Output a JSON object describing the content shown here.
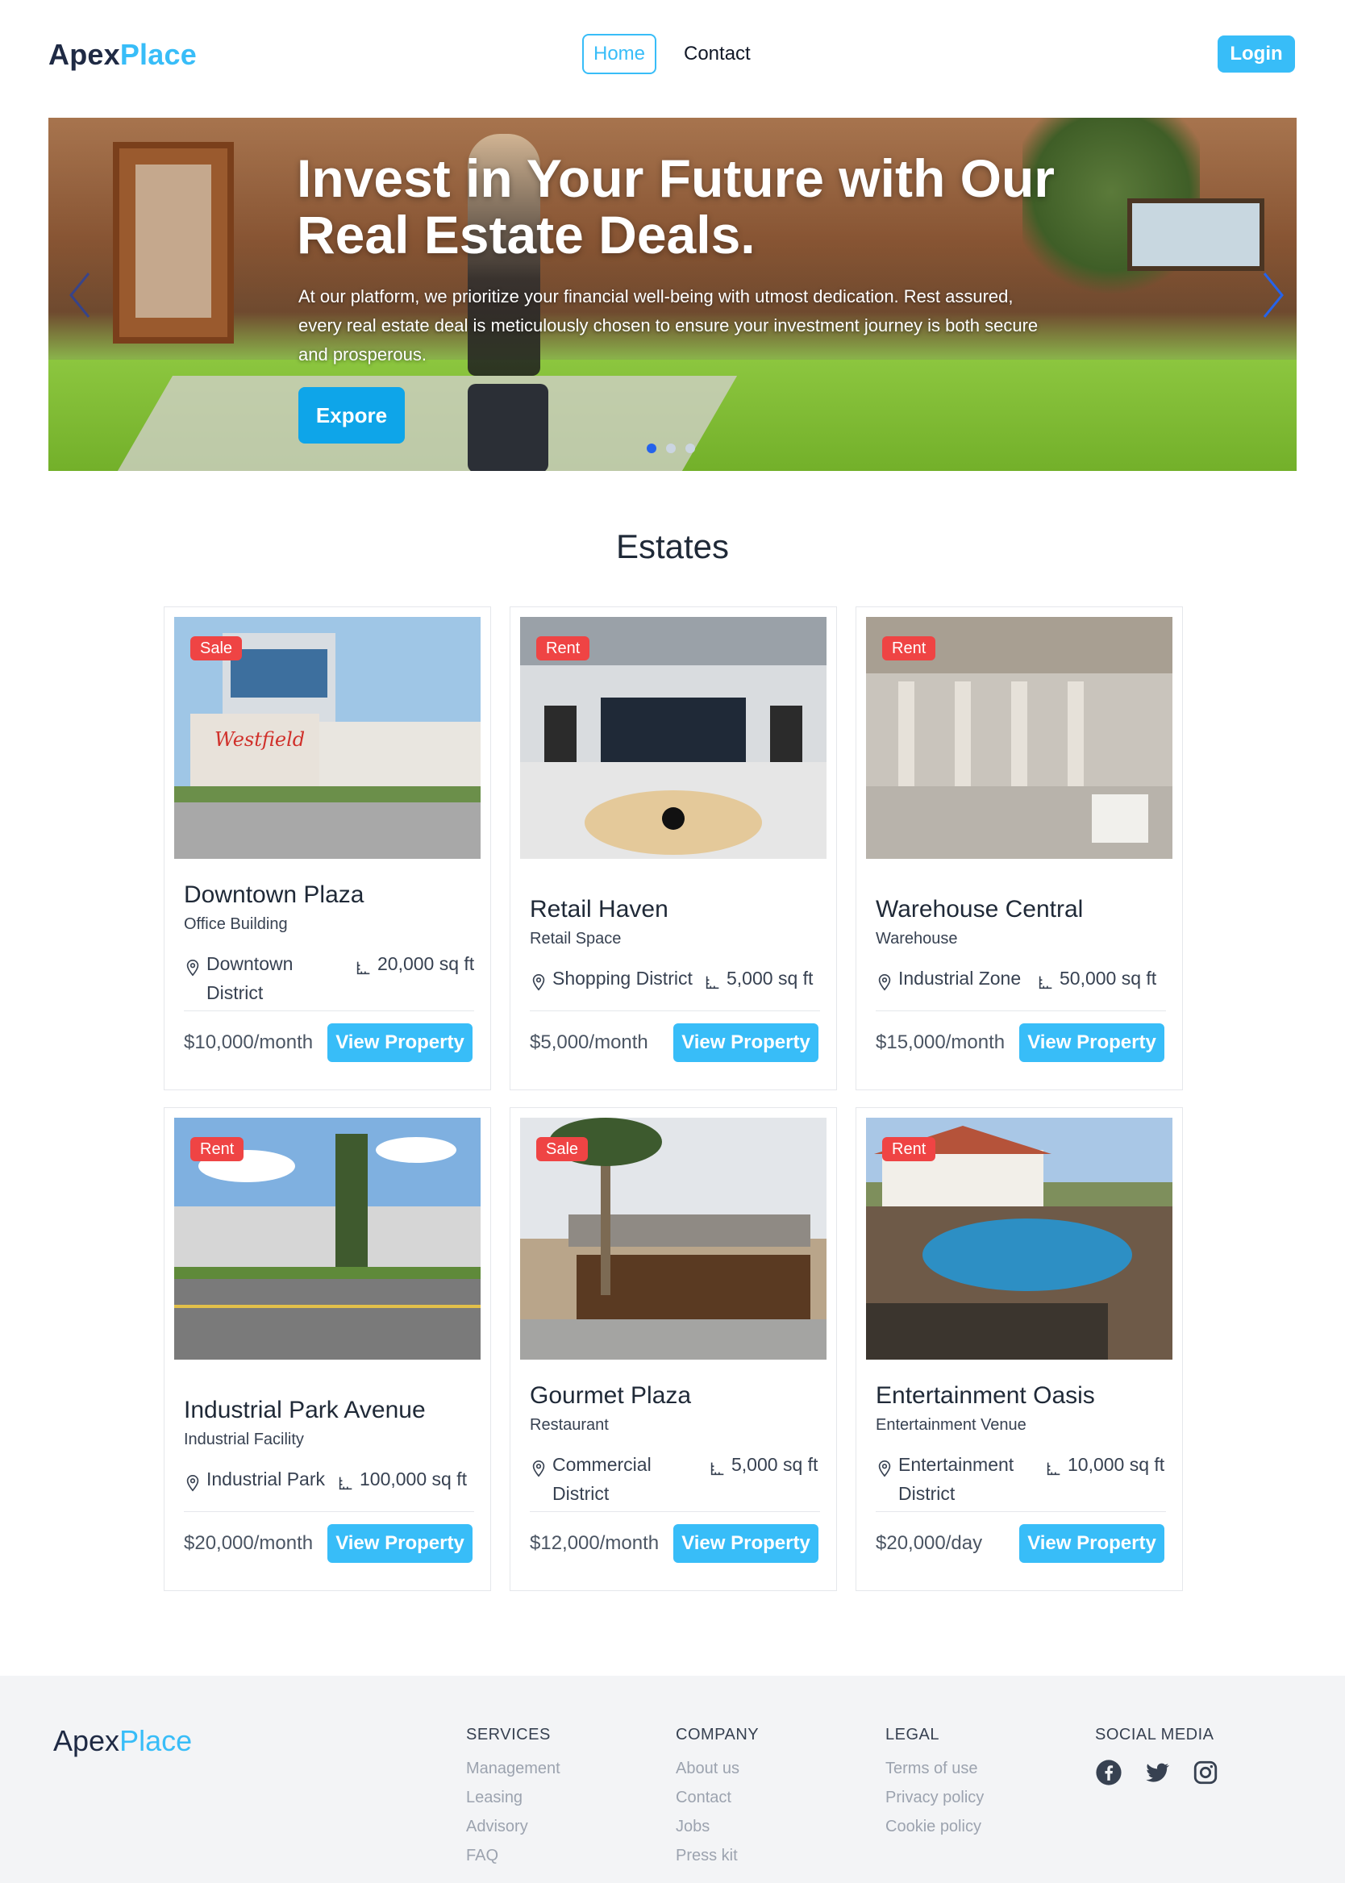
{
  "header": {
    "logo_part1": "Apex",
    "logo_part2": "Place",
    "nav": {
      "home": "Home",
      "contact": "Contact"
    },
    "login": "Login"
  },
  "hero": {
    "title": "Invest in Your Future with Our Real Estate Deals.",
    "text": "At our platform, we prioritize your financial well-being with utmost dedication. Rest assured, every real estate deal is meticulously chosen to ensure your investment journey is both secure and prosperous.",
    "button": "Expore",
    "slide_count": 3,
    "active_slide": 1
  },
  "estates": {
    "title": "Estates",
    "cards": [
      {
        "badge": "Sale",
        "name": "Downtown Plaza",
        "type": "Office Building",
        "location": "Downtown District",
        "area": "20,000 sq ft",
        "price": "$10,000/month",
        "button": "View Property"
      },
      {
        "badge": "Rent",
        "name": "Retail Haven",
        "type": "Retail Space",
        "location": "Shopping District",
        "area": "5,000 sq ft",
        "price": "$5,000/month",
        "button": "View Property"
      },
      {
        "badge": "Rent",
        "name": "Warehouse Central",
        "type": "Warehouse",
        "location": "Industrial Zone",
        "area": "50,000 sq ft",
        "price": "$15,000/month",
        "button": "View Property"
      },
      {
        "badge": "Rent",
        "name": "Industrial Park Avenue",
        "type": "Industrial Facility",
        "location": "Industrial Park",
        "area": "100,000 sq ft",
        "price": "$20,000/month",
        "button": "View Property"
      },
      {
        "badge": "Sale",
        "name": "Gourmet Plaza",
        "type": "Restaurant",
        "location": "Commercial District",
        "area": "5,000 sq ft",
        "price": "$12,000/month",
        "button": "View Property"
      },
      {
        "badge": "Rent",
        "name": "Entertainment Oasis",
        "type": "Entertainment Venue",
        "location": "Entertainment District",
        "area": "10,000 sq ft",
        "price": "$20,000/day",
        "button": "View Property"
      }
    ]
  },
  "footer": {
    "logo_part1": "Apex",
    "logo_part2": "Place",
    "services": {
      "title": "SERVICES",
      "links": [
        "Management",
        "Leasing",
        "Advisory",
        "FAQ"
      ]
    },
    "company": {
      "title": "COMPANY",
      "links": [
        "About us",
        "Contact",
        "Jobs",
        "Press kit"
      ]
    },
    "legal": {
      "title": "LEGAL",
      "links": [
        "Terms of use",
        "Privacy policy",
        "Cookie policy"
      ]
    },
    "social": {
      "title": "SOCIAL MEDIA",
      "icons": [
        "facebook-icon",
        "twitter-icon",
        "instagram-icon"
      ]
    }
  },
  "colors": {
    "accent": "#38bdf8",
    "badge": "#ef4444",
    "dark": "#1f2a44"
  }
}
